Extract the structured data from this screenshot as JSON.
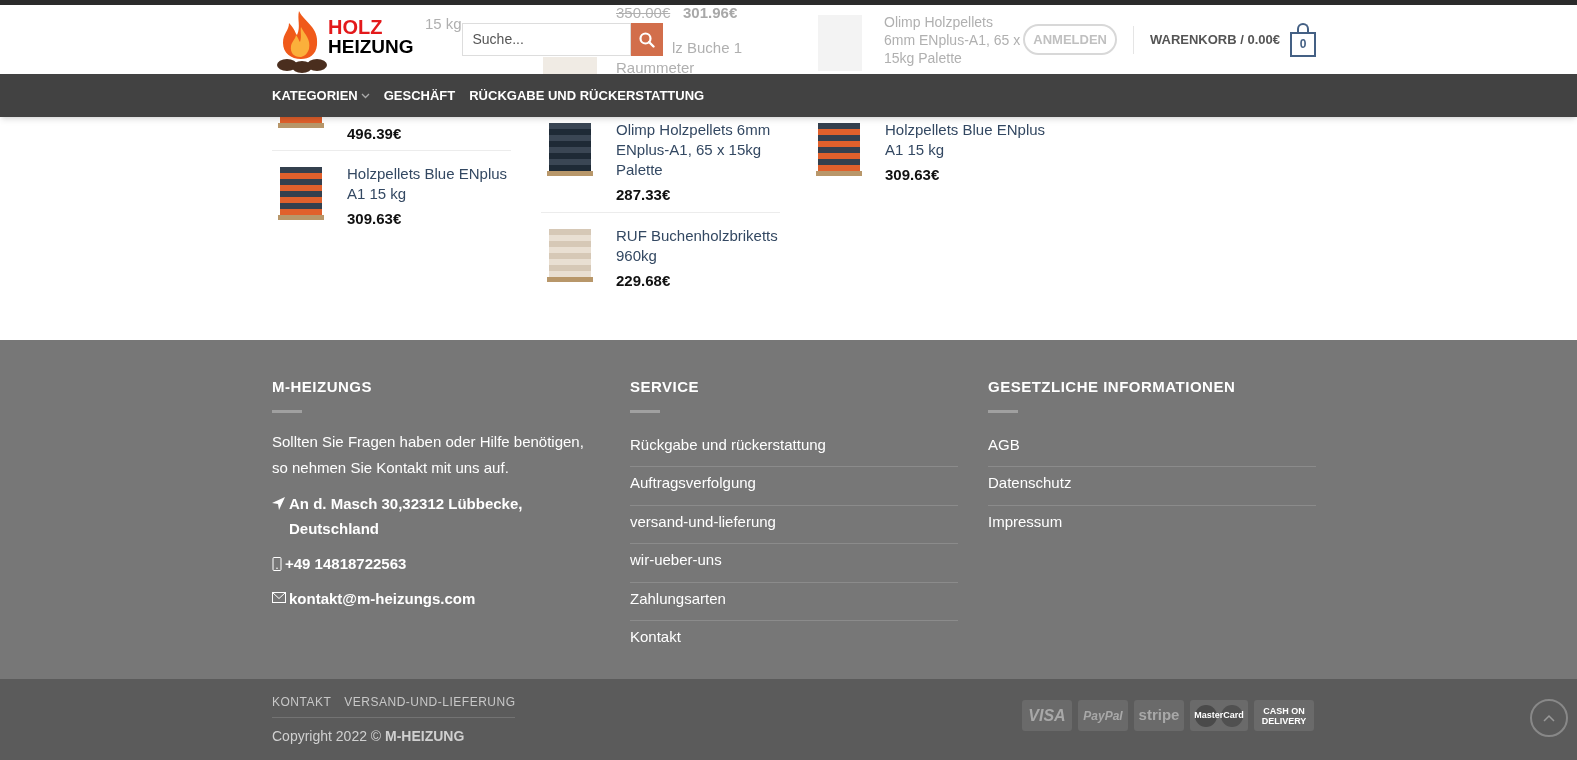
{
  "header": {
    "logo": {
      "line_1": "HOLZ",
      "line_2": "HEIZUNG"
    },
    "search": {
      "placeholder": "Suche..."
    },
    "login_button": "ANMELDEN",
    "cart": {
      "label": "WARENKORB / 0.00€",
      "count": "0"
    }
  },
  "behind_header": {
    "column_1": {
      "name": "15 kg"
    },
    "column_2": {
      "old_price": "350.00€",
      "price": "301.96€",
      "name_lines": [
        "lz Buche 1",
        "Raummeter"
      ]
    },
    "column_3": {
      "name": "Olimp Holzpellets 6mm ENplus-A1, 65 x 15kg Palette"
    }
  },
  "nav": [
    {
      "label": "KATEGORIEN",
      "dropdown": true
    },
    {
      "label": "GESCHÄFT",
      "dropdown": false
    },
    {
      "label": "RÜCKGABE UND RÜCKERSTATTUNG",
      "dropdown": false
    }
  ],
  "products": [
    [
      {
        "kind": "pellet-pallet",
        "partial": true,
        "price": "496.39€"
      },
      {
        "kind": "pellet-pallet",
        "partial": false,
        "name": "Holzpellets Blue ENplus A1 15 kg",
        "price": "309.63€"
      }
    ],
    [
      {
        "kind": "bag-pallet",
        "partial": false,
        "name": "Olimp Holzpellets 6mm ENplus-A1, 65 x 15kg Palette",
        "price": "287.33€"
      },
      {
        "kind": "briquette-pallet",
        "partial": false,
        "name": "RUF Buchenholzbriketts 960kg",
        "price": "229.68€"
      }
    ],
    [
      {
        "kind": "pellet-pallet",
        "partial": false,
        "name": "Holzpellets Blue ENplus A1 15 kg",
        "price": "309.63€"
      }
    ]
  ],
  "footer": {
    "columns": [
      {
        "title": "M-HEIZUNGS",
        "text": "Sollten Sie Fragen haben oder Hilfe benötigen, so nehmen Sie Kontakt mit uns auf.",
        "contacts": [
          {
            "kind": "address",
            "text": "An d. Masch 30,32312 Lübbecke, Deutschland"
          },
          {
            "kind": "phone",
            "text": "+49 14818722563"
          },
          {
            "kind": "email",
            "text": "kontakt@m-heizungs.com"
          }
        ]
      },
      {
        "title": "SERVICE",
        "links": [
          "Rückgabe und rückerstattung",
          "Auftragsverfolgung",
          "versand-und-lieferung",
          "wir-ueber-uns",
          "Zahlungsarten",
          "Kontakt"
        ]
      },
      {
        "title": "GESETZLICHE INFORMATIONEN",
        "links": [
          "AGB",
          "Datenschutz",
          "Impressum"
        ]
      }
    ],
    "bottom": {
      "links": [
        "KONTAKT",
        "VERSAND-UND-LIEFERUNG"
      ],
      "copyright": "Copyright 2022 © **M-HEIZUNG**",
      "payments": [
        {
          "kind": "visa",
          "label": "VISA"
        },
        {
          "kind": "paypal",
          "label": "PayPal"
        },
        {
          "kind": "stripe",
          "label": "stripe"
        },
        {
          "kind": "mastercard",
          "label": "MasterCard"
        },
        {
          "kind": "cod",
          "label": "CASH ON DELIVERY"
        }
      ]
    }
  }
}
